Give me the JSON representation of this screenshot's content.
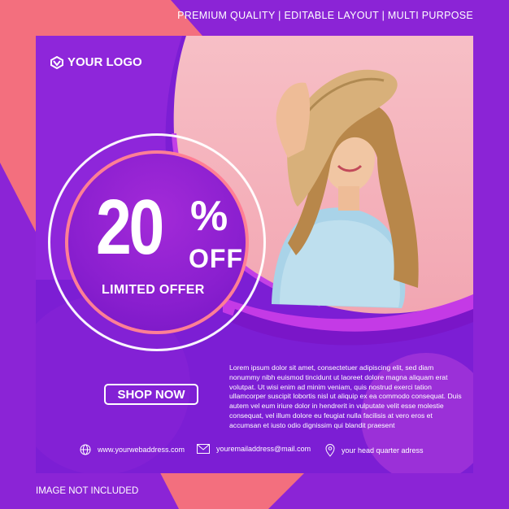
{
  "header": {
    "tagline": "PREMIUM QUALITY  |  EDITABLE LAYOUT  |  MULTI PURPOSE"
  },
  "logo": {
    "text": "YOUR LOGO"
  },
  "offer": {
    "number": "20",
    "percent": "%",
    "off": "OFF",
    "subtitle": "LIMITED OFFER"
  },
  "cta": {
    "label": "SHOP NOW"
  },
  "body_text": "Lorem ipsum dolor sit amet, consectetuer adipiscing elit, sed diam nonummy nibh euismod tincidunt ut laoreet dolore magna aliquam erat volutpat. Ut wisi enim ad minim veniam, quis nostrud exerci tation ullamcorper suscipit lobortis nisl ut aliquip ex ea commodo consequat. Duis autem vel eum iriure dolor in hendrerit in vulputate velit esse molestie consequat, vel illum dolore eu feugiat nulla facilisis at vero eros et accumsan et iusto odio dignissim qui blandit praesent",
  "footer": {
    "web": {
      "icon": "globe-icon",
      "text": "www.yourwebaddress.com"
    },
    "email": {
      "icon": "envelope-icon",
      "text": "youremailaddress@mail.com"
    },
    "address": {
      "icon": "location-pin-icon",
      "text": "your head quarter adress"
    }
  },
  "disclaimer": "IMAGE NOT INCLUDED",
  "colors": {
    "coral": "#f36f7e",
    "purple": "#7a1cd4",
    "pink_ring": "#ff7f95",
    "white": "#ffffff"
  }
}
